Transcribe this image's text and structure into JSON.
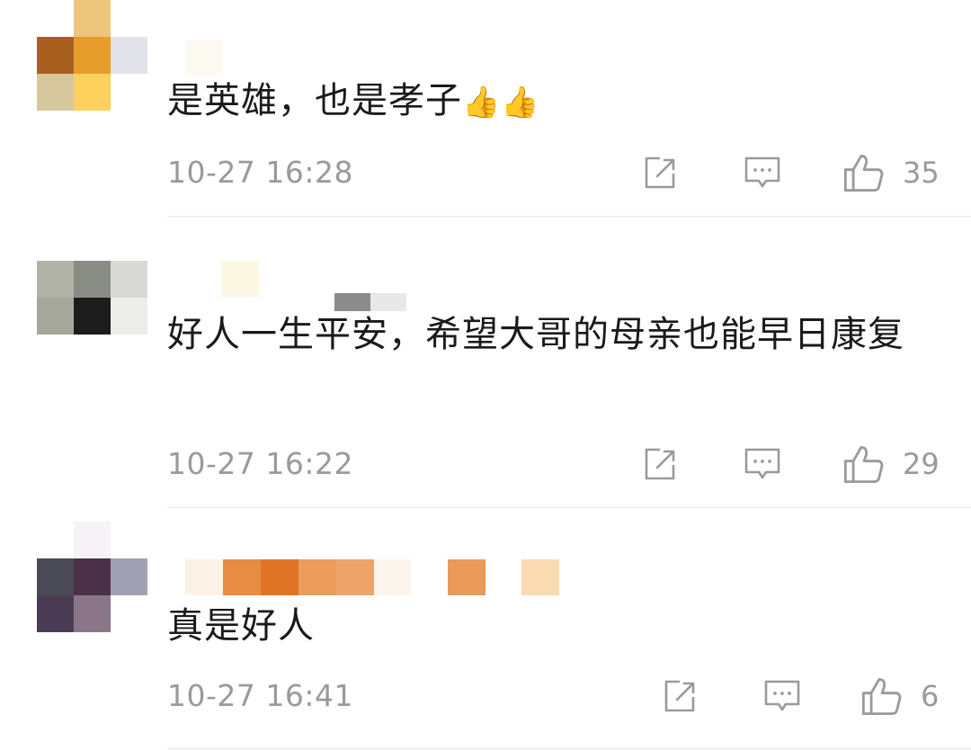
{
  "comments": [
    {
      "text": "是英雄，也是孝子",
      "emoji": "👍👍",
      "time": "10-27 16:28",
      "likes": "35"
    },
    {
      "text": "好人一生平安，希望大哥的母亲也能早日康复",
      "time": "10-27 16:22",
      "likes": "29"
    },
    {
      "text": "真是好人",
      "time": "10-27 16:41",
      "likes": "6"
    }
  ],
  "icons": {
    "share": "share-icon",
    "reply": "reply-icon",
    "like": "like-icon"
  },
  "colors": {
    "text": "#1a1a1a",
    "meta": "#9a9a9a",
    "divider": "#e6e6e6"
  }
}
